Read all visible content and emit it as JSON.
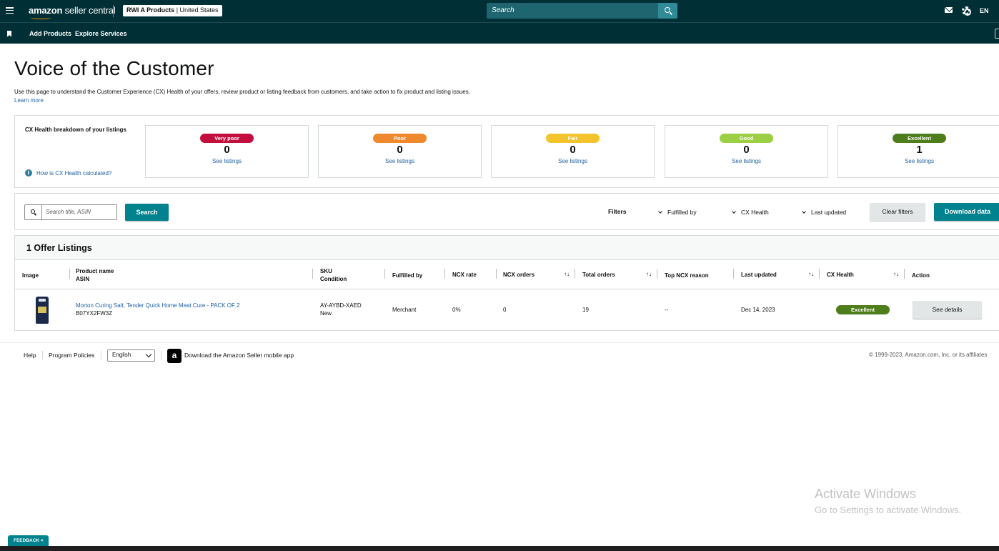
{
  "header": {
    "brand_bold": "amazon",
    "brand_light": " seller central",
    "store_name": "RWI A Products",
    "store_region": "| United States",
    "search_placeholder": "Search",
    "language": "EN"
  },
  "subnav": {
    "links": [
      "Add Products",
      "Explore Services"
    ]
  },
  "page": {
    "title": "Voice of the Customer",
    "description": "Use this page to understand the Customer Experience (CX) Health of your offers, review product or listing feedback from customers, and take action to fix product and listing issues.",
    "learn_more": "Learn more"
  },
  "cx_breakdown": {
    "heading": "CX Health breakdown of your listings",
    "how_calculated": "How is CX Health calculated?",
    "cards": [
      {
        "label": "Very poor",
        "count": "0",
        "link": "See listings",
        "color": "#c40f3e",
        "text_color": "#ffffff"
      },
      {
        "label": "Poor",
        "count": "0",
        "link": "See listings",
        "color": "#f0892b",
        "text_color": "#ffffff"
      },
      {
        "label": "Fair",
        "count": "0",
        "link": "See listings",
        "color": "#f4c42c",
        "text_color": "#ffffff"
      },
      {
        "label": "Good",
        "count": "0",
        "link": "See listings",
        "color": "#9ccf44",
        "text_color": "#ffffff"
      },
      {
        "label": "Excellent",
        "count": "1",
        "link": "See listings",
        "color": "#4e7d1c",
        "text_color": "#ffffff"
      }
    ]
  },
  "filters": {
    "search_placeholder": "Search title, ASIN",
    "search_button": "Search",
    "label": "Filters",
    "dropdowns": [
      "Fulfilled by",
      "CX Health",
      "Last updated"
    ],
    "clear_button": "Clear filters",
    "download_button": "Download data"
  },
  "table": {
    "title": "1 Offer Listings",
    "headers": {
      "image": "Image",
      "product_name": "Product name",
      "asin": "ASIN",
      "sku": "SKU",
      "condition": "Condition",
      "fulfilled_by": "Fulfilled by",
      "ncx_rate": "NCX rate",
      "ncx_orders": "NCX orders",
      "total_orders": "Total orders",
      "top_ncx_reason": "Top NCX reason",
      "last_updated": "Last updated",
      "cx_health": "CX Health",
      "action": "Action"
    },
    "sort_glyph": "↑↓",
    "rows": [
      {
        "product_name": "Morton Curing Salt, Tender Quick Home Meat Cure - PACK OF 2",
        "asin": "B07YX2FW3Z",
        "sku": "AY-AYBD-XAED",
        "condition": "New",
        "fulfilled_by": "Merchant",
        "ncx_rate": "0%",
        "ncx_orders": "0",
        "total_orders": "19",
        "top_ncx_reason": "--",
        "last_updated": "Dec 14, 2023",
        "cx_health": "Excellent",
        "action": "See details"
      }
    ]
  },
  "footer": {
    "help": "Help",
    "program_policies": "Program Policies",
    "language_select": "English",
    "app_icon_glyph": "a",
    "app_download": "Download the Amazon Seller mobile app",
    "copyright": "© 1999-2023, Amazon.com, Inc. or its affiliates"
  },
  "overlay": {
    "watermark_title": "Activate Windows",
    "watermark_subtitle": "Go to Settings to activate Windows.",
    "feedback": "FEEDBACK ×"
  }
}
